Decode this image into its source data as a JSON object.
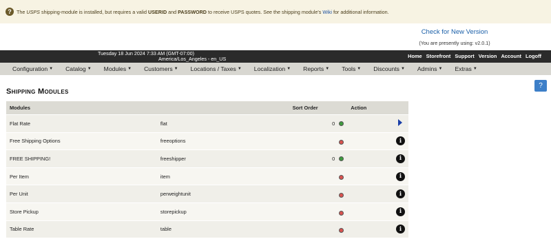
{
  "notice": {
    "pre": "The",
    "module": "USPS",
    "mid1": "shipping-module is installed, but requires a valid",
    "userid": "USERID",
    "and": "and",
    "password": "PASSWORD",
    "mid2": "to receive USPS quotes. See the shipping module's",
    "wiki": "Wiki",
    "post": "for additional information."
  },
  "version": {
    "check_link": "Check for New Version",
    "using": "(You are presently using: v2.0.1)"
  },
  "topbar": {
    "date": "Tuesday 18 Jun 2024 7:33 AM (GMT-07:00)",
    "timezone": "America/Los_Angeles - en_US",
    "links": [
      "Home",
      "Storefront",
      "Support",
      "Version",
      "Account",
      "Logoff"
    ]
  },
  "menu": [
    "Configuration",
    "Catalog",
    "Modules",
    "Customers",
    "Locations / Taxes",
    "Localization",
    "Reports",
    "Tools",
    "Discounts",
    "Admins",
    "Extras"
  ],
  "help_label": "?",
  "page_title": "Shipping Modules",
  "table": {
    "headers": {
      "modules": "Modules",
      "sort_order": "Sort Order",
      "action": "Action"
    },
    "rows": [
      {
        "title": "Flat Rate",
        "code": "flat",
        "sort": "0",
        "status": "green",
        "action": "selected"
      },
      {
        "title": "Free Shipping Options",
        "code": "freeoptions",
        "sort": "",
        "status": "red",
        "action": "info"
      },
      {
        "title": "FREE SHIPPING!",
        "code": "freeshipper",
        "sort": "0",
        "status": "green",
        "action": "info"
      },
      {
        "title": "Per Item",
        "code": "item",
        "sort": "",
        "status": "red",
        "action": "info"
      },
      {
        "title": "Per Unit",
        "code": "perweightunit",
        "sort": "",
        "status": "red",
        "action": "info"
      },
      {
        "title": "Store Pickup",
        "code": "storepickup",
        "sort": "",
        "status": "red",
        "action": "info"
      },
      {
        "title": "Table Rate",
        "code": "table",
        "sort": "",
        "status": "red",
        "action": "info"
      }
    ]
  },
  "colors": {
    "green": "#3e9a3e",
    "red": "#d9534f",
    "accent": "#3d7fc8"
  },
  "icons": {
    "selected": "play-arrow-icon",
    "info": "info-icon"
  }
}
